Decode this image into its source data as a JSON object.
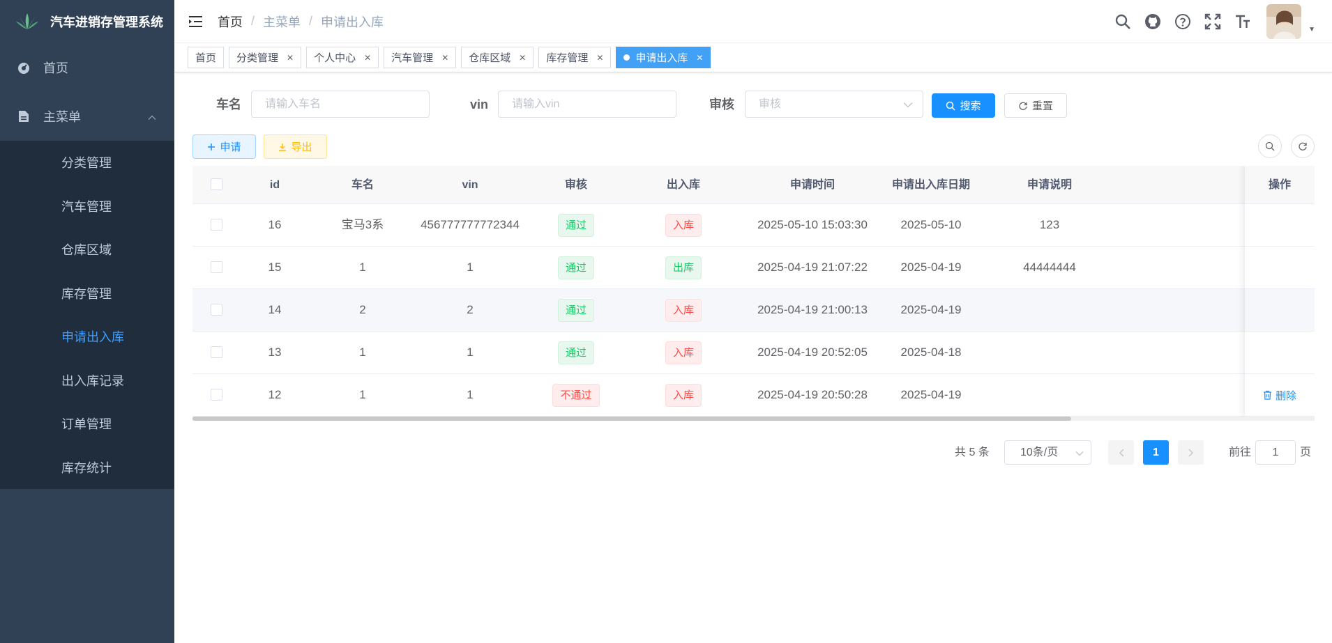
{
  "app": {
    "title": "汽车进销存管理系统"
  },
  "sidebar": {
    "home": "首页",
    "main_menu": "主菜单",
    "items": [
      {
        "label": "分类管理"
      },
      {
        "label": "汽车管理"
      },
      {
        "label": "仓库区域"
      },
      {
        "label": "库存管理"
      },
      {
        "label": "申请出入库",
        "active": true
      },
      {
        "label": "出入库记录"
      },
      {
        "label": "订单管理"
      },
      {
        "label": "库存统计"
      }
    ]
  },
  "breadcrumb": [
    "首页",
    "主菜单",
    "申请出入库"
  ],
  "tags": [
    {
      "label": "首页"
    },
    {
      "label": "分类管理"
    },
    {
      "label": "个人中心"
    },
    {
      "label": "汽车管理"
    },
    {
      "label": "仓库区域"
    },
    {
      "label": "库存管理"
    },
    {
      "label": "申请出入库",
      "active": true
    }
  ],
  "search": {
    "car_name_label": "车名",
    "car_name_placeholder": "请输入车名",
    "vin_label": "vin",
    "vin_placeholder": "请输入vin",
    "audit_label": "审核",
    "audit_placeholder": "审核",
    "search_btn": "搜索",
    "reset_btn": "重置"
  },
  "toolbar": {
    "apply_btn": "申请",
    "export_btn": "导出"
  },
  "table": {
    "columns": [
      "id",
      "车名",
      "vin",
      "审核",
      "出入库",
      "申请时间",
      "申请出入库日期",
      "申请说明",
      "操作"
    ],
    "rows": [
      {
        "id": "16",
        "name": "宝马3系",
        "vin": "456777777772344",
        "audit": "通过",
        "audit_status": "green",
        "io": "入库",
        "io_status": "red",
        "time": "2025-05-10 15:03:30",
        "date": "2025-05-10",
        "note": "123",
        "op": ""
      },
      {
        "id": "15",
        "name": "1",
        "vin": "1",
        "audit": "通过",
        "audit_status": "green",
        "io": "出库",
        "io_status": "green",
        "time": "2025-04-19 21:07:22",
        "date": "2025-04-19",
        "note": "44444444",
        "op": ""
      },
      {
        "id": "14",
        "name": "2",
        "vin": "2",
        "audit": "通过",
        "audit_status": "green",
        "io": "入库",
        "io_status": "red",
        "time": "2025-04-19 21:00:13",
        "date": "2025-04-19",
        "note": "",
        "op": ""
      },
      {
        "id": "13",
        "name": "1",
        "vin": "1",
        "audit": "通过",
        "audit_status": "green",
        "io": "入库",
        "io_status": "red",
        "time": "2025-04-19 20:52:05",
        "date": "2025-04-18",
        "note": "",
        "op": ""
      },
      {
        "id": "12",
        "name": "1",
        "vin": "1",
        "audit": "不通过",
        "audit_status": "red",
        "io": "入库",
        "io_status": "red",
        "time": "2025-04-19 20:50:28",
        "date": "2025-04-19",
        "note": "",
        "op": "删除"
      }
    ]
  },
  "pagination": {
    "total": "共 5 条",
    "page_size": "10条/页",
    "current": "1",
    "goto_prefix": "前往",
    "goto_value": "1",
    "goto_suffix": "页"
  },
  "colors": {
    "sidebar_bg": "#304156",
    "submenu_bg": "#1f2d3d",
    "primary": "#1890ff",
    "success": "#13ce66",
    "danger": "#ff4949",
    "warning": "#ffba00"
  }
}
